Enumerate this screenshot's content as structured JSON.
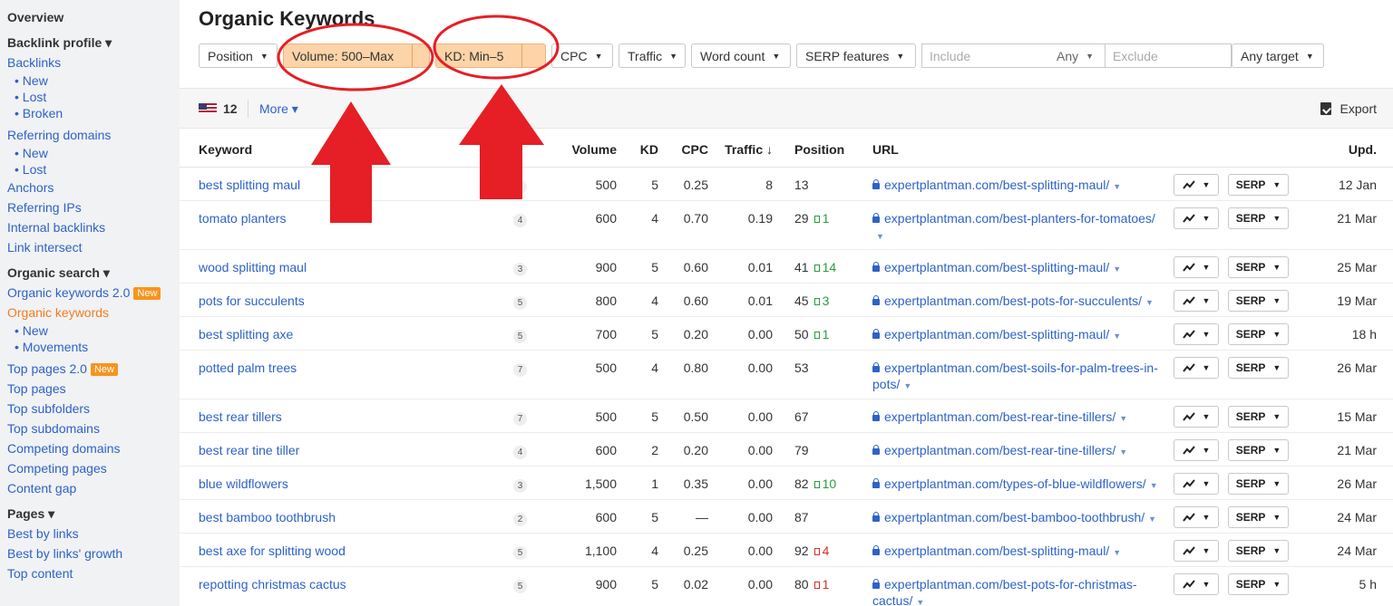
{
  "sidebar": {
    "overview": "Overview",
    "backlink_profile": "Backlink profile ▾",
    "backlinks": "Backlinks",
    "backlinks_new": "New",
    "backlinks_lost": "Lost",
    "backlinks_broken": "Broken",
    "referring_domains": "Referring domains",
    "rd_new": "New",
    "rd_lost": "Lost",
    "anchors": "Anchors",
    "referring_ips": "Referring IPs",
    "internal_backlinks": "Internal backlinks",
    "link_intersect": "Link intersect",
    "organic_search": "Organic search ▾",
    "organic_keywords_2": "Organic keywords 2.0",
    "new_badge": "New",
    "organic_keywords": "Organic keywords",
    "ok_new": "New",
    "ok_movements": "Movements",
    "top_pages_2": "Top pages 2.0",
    "top_pages": "Top pages",
    "top_subfolders": "Top subfolders",
    "top_subdomains": "Top subdomains",
    "competing_domains": "Competing domains",
    "competing_pages": "Competing pages",
    "content_gap": "Content gap",
    "pages": "Pages ▾",
    "best_by_links": "Best by links",
    "best_by_links_growth": "Best by links' growth",
    "top_content": "Top content"
  },
  "main": {
    "title": "Organic Keywords",
    "filters": {
      "position": "Position",
      "volume": "Volume: 500–Max",
      "kd": "KD: Min–5",
      "cpc": "CPC",
      "traffic": "Traffic",
      "word_count": "Word count",
      "serp_features": "SERP features",
      "include_placeholder": "Include",
      "any": "Any",
      "exclude_placeholder": "Exclude",
      "any_target": "Any target"
    },
    "toolbar": {
      "count": "12",
      "more": "More ▾",
      "export": "Export"
    },
    "table": {
      "headers": {
        "keyword": "Keyword",
        "volume": "Volume",
        "kd": "KD",
        "cpc": "CPC",
        "traffic": "Traffic ↓",
        "position": "Position",
        "url": "URL",
        "upd": "Upd."
      },
      "serp_label": "SERP",
      "rows": [
        {
          "keyword": "best splitting maul",
          "sf": "5",
          "volume": "500",
          "kd": "5",
          "cpc": "0.25",
          "traffic": "8",
          "position": "13",
          "change": "",
          "dir": "",
          "url": "expertplantman.com/best-splitting-maul/",
          "upd": "12 Jan"
        },
        {
          "keyword": "tomato planters",
          "sf": "4",
          "volume": "600",
          "kd": "4",
          "cpc": "0.70",
          "traffic": "0.19",
          "position": "29",
          "change": "1",
          "dir": "up",
          "url": "expertplantman.com/best-planters-for-tomatoes/",
          "upd": "21 Mar"
        },
        {
          "keyword": "wood splitting maul",
          "sf": "3",
          "volume": "900",
          "kd": "5",
          "cpc": "0.60",
          "traffic": "0.01",
          "position": "41",
          "change": "14",
          "dir": "up",
          "url": "expertplantman.com/best-splitting-maul/",
          "upd": "25 Mar"
        },
        {
          "keyword": "pots for succulents",
          "sf": "5",
          "volume": "800",
          "kd": "4",
          "cpc": "0.60",
          "traffic": "0.01",
          "position": "45",
          "change": "3",
          "dir": "up",
          "url": "expertplantman.com/best-pots-for-succulents/",
          "upd": "19 Mar"
        },
        {
          "keyword": "best splitting axe",
          "sf": "5",
          "volume": "700",
          "kd": "5",
          "cpc": "0.20",
          "traffic": "0.00",
          "position": "50",
          "change": "1",
          "dir": "up",
          "url": "expertplantman.com/best-splitting-maul/",
          "upd": "18 h"
        },
        {
          "keyword": "potted palm trees",
          "sf": "7",
          "volume": "500",
          "kd": "4",
          "cpc": "0.80",
          "traffic": "0.00",
          "position": "53",
          "change": "",
          "dir": "",
          "url": "expertplantman.com/best-soils-for-palm-trees-in-pots/",
          "upd": "26 Mar"
        },
        {
          "keyword": "best rear tillers",
          "sf": "7",
          "volume": "500",
          "kd": "5",
          "cpc": "0.50",
          "traffic": "0.00",
          "position": "67",
          "change": "",
          "dir": "",
          "url": "expertplantman.com/best-rear-tine-tillers/",
          "upd": "15 Mar"
        },
        {
          "keyword": "best rear tine tiller",
          "sf": "4",
          "volume": "600",
          "kd": "2",
          "cpc": "0.20",
          "traffic": "0.00",
          "position": "79",
          "change": "",
          "dir": "",
          "url": "expertplantman.com/best-rear-tine-tillers/",
          "upd": "21 Mar"
        },
        {
          "keyword": "blue wildflowers",
          "sf": "3",
          "volume": "1,500",
          "kd": "1",
          "cpc": "0.35",
          "traffic": "0.00",
          "position": "82",
          "change": "10",
          "dir": "up",
          "url": "expertplantman.com/types-of-blue-wildflowers/",
          "upd": "26 Mar"
        },
        {
          "keyword": "best bamboo toothbrush",
          "sf": "2",
          "volume": "600",
          "kd": "5",
          "cpc": "—",
          "traffic": "0.00",
          "position": "87",
          "change": "",
          "dir": "",
          "url": "expertplantman.com/best-bamboo-toothbrush/",
          "upd": "24 Mar"
        },
        {
          "keyword": "best axe for splitting wood",
          "sf": "5",
          "volume": "1,100",
          "kd": "4",
          "cpc": "0.25",
          "traffic": "0.00",
          "position": "92",
          "change": "4",
          "dir": "down",
          "url": "expertplantman.com/best-splitting-maul/",
          "upd": "24 Mar"
        },
        {
          "keyword": "repotting christmas cactus",
          "sf": "5",
          "volume": "900",
          "kd": "5",
          "cpc": "0.02",
          "traffic": "0.00",
          "position": "80",
          "change": "1",
          "dir": "down",
          "url": "expertplantman.com/best-pots-for-christmas-cactus/",
          "upd": "5 h"
        }
      ]
    }
  },
  "colors": {
    "link": "#2d62c8",
    "active": "#f47b20",
    "highlight": "#fcd4a7",
    "annotation": "#e61e25",
    "up": "#2a9d3c",
    "down": "#d0332b"
  }
}
